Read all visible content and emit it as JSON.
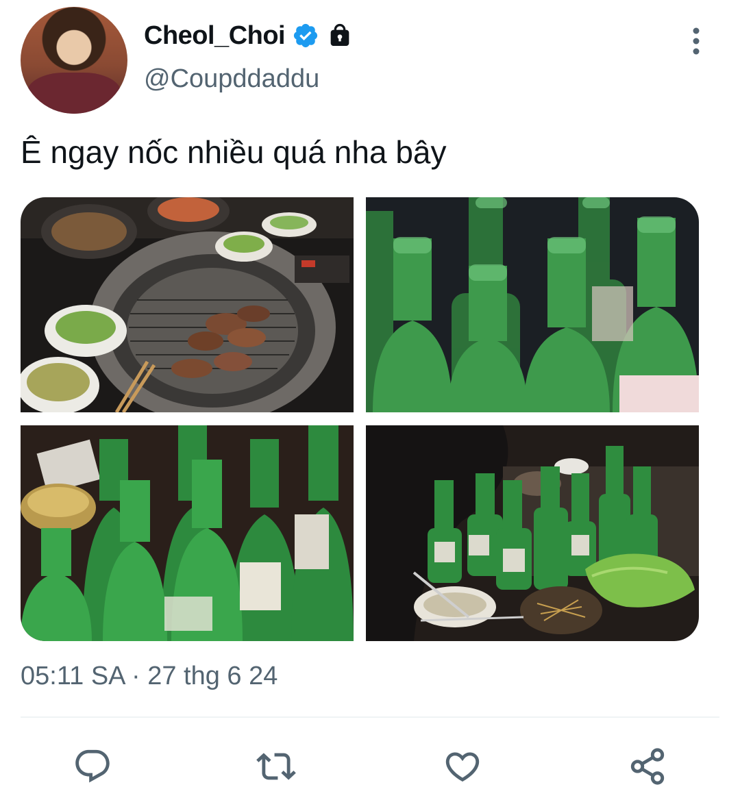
{
  "user": {
    "display_name": "Cheol_Choi",
    "handle": "@Coupddaddu",
    "verified": true,
    "protected": true
  },
  "tweet": {
    "text": "Ê ngay nốc nhiều quá nha bây",
    "timestamp": "05:11 SA · 27 thg 6 24"
  },
  "media": [
    {
      "icon": "korean-bbq-grill-photo"
    },
    {
      "icon": "green-soju-bottles-photo"
    },
    {
      "icon": "soju-bottles-table-photo"
    },
    {
      "icon": "table-with-bottles-and-lettuce-photo"
    }
  ],
  "actions": [
    {
      "icon": "reply-icon"
    },
    {
      "icon": "retweet-icon"
    },
    {
      "icon": "like-icon"
    },
    {
      "icon": "share-icon"
    }
  ],
  "colors": {
    "text": "#0f1419",
    "secondary": "#536471",
    "verified": "#1d9bf0",
    "divider": "#eff3f4"
  }
}
